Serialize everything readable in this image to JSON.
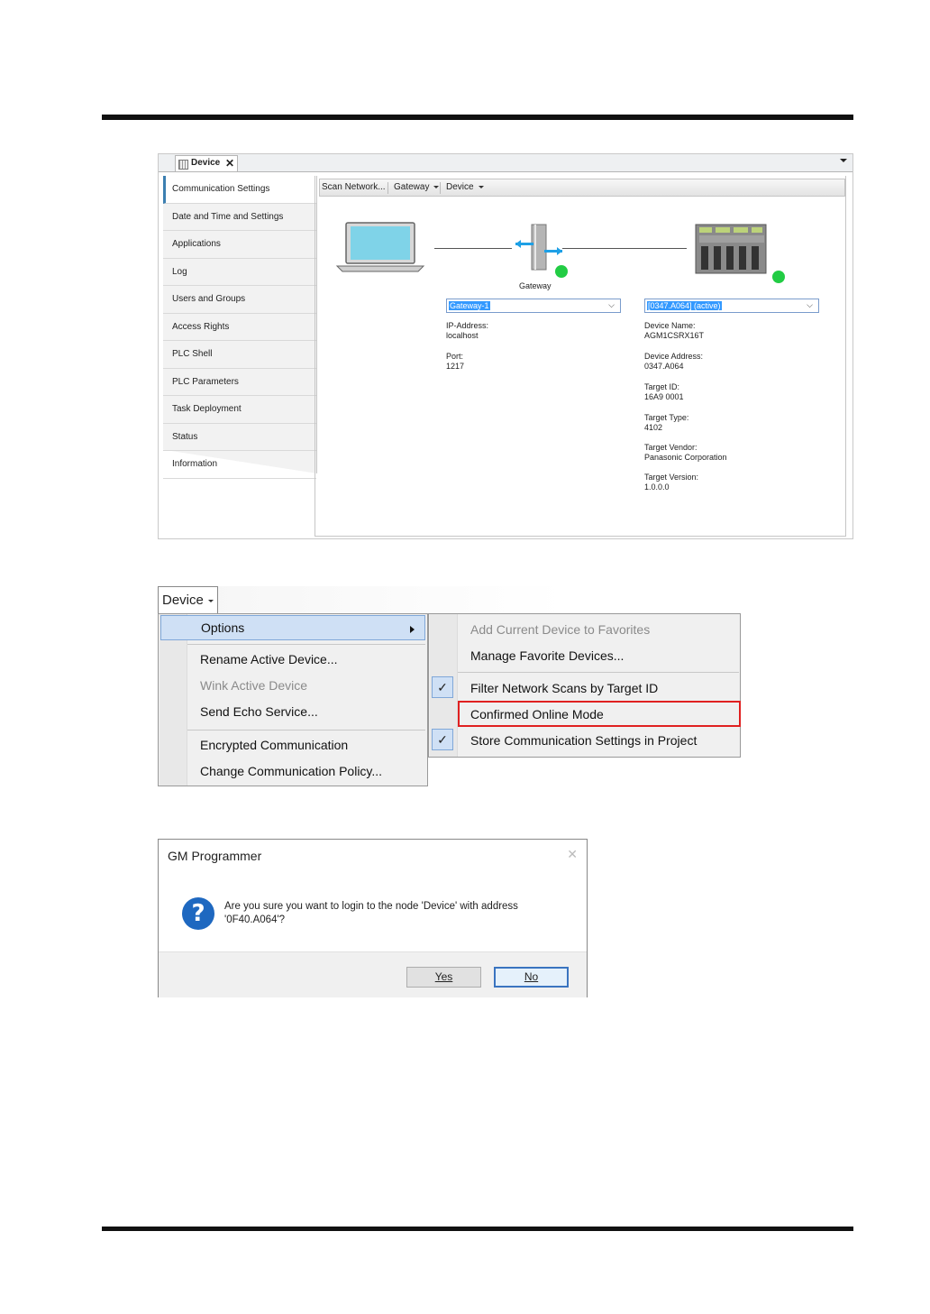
{
  "panel1": {
    "tab": {
      "title": "Device",
      "close": "✕"
    },
    "nav": [
      "Communication Settings",
      "Date and Time and Settings",
      "Applications",
      "Log",
      "Users and Groups",
      "Access Rights",
      "PLC Shell",
      "PLC Parameters",
      "Task Deployment",
      "Status",
      "Information"
    ],
    "toolbar": {
      "scan": "Scan Network...",
      "gateway": "Gateway",
      "device": "Device"
    },
    "gateway": {
      "caption": "Gateway",
      "combo": "Gateway-1",
      "ip_label": "IP-Address:",
      "ip_value": "localhost",
      "port_label": "Port:",
      "port_value": "1217",
      "status_color": "#22cc44"
    },
    "device": {
      "combo": "[0347.A064] (active)",
      "name_label": "Device Name:",
      "name_value": "AGM1CSRX16T",
      "address_label": "Device Address:",
      "address_value": "0347.A064",
      "target_id_label": "Target ID:",
      "target_id_value": "16A9  0001",
      "target_type_label": "Target Type:",
      "target_type_value": "4102",
      "vendor_label": "Target Vendor:",
      "vendor_value": "Panasonic Corporation",
      "version_label": "Target Version:",
      "version_value": "1.0.0.0",
      "status_color": "#22cc44"
    }
  },
  "panel2": {
    "menu_button": "Device",
    "menu": {
      "options": "Options",
      "rename": "Rename Active Device...",
      "wink": "Wink Active Device",
      "echo": "Send Echo Service...",
      "encrypted": "Encrypted Communication",
      "policy": "Change Communication Policy..."
    },
    "submenu": {
      "add_fav": "Add Current Device to Favorites",
      "manage_fav": "Manage Favorite Devices...",
      "filter": "Filter Network Scans by Target ID",
      "confirmed": "Confirmed Online Mode",
      "store": "Store Communication Settings in Project",
      "check_mark": "✓"
    },
    "highlight_color": "#e02020"
  },
  "panel3": {
    "title": "GM Programmer",
    "close": "✕",
    "icon": "?",
    "message_line1": "Are you sure you want to login to the node 'Device' with address",
    "message_line2": "'0F40.A064'?",
    "yes": "Yes",
    "no": "No"
  }
}
